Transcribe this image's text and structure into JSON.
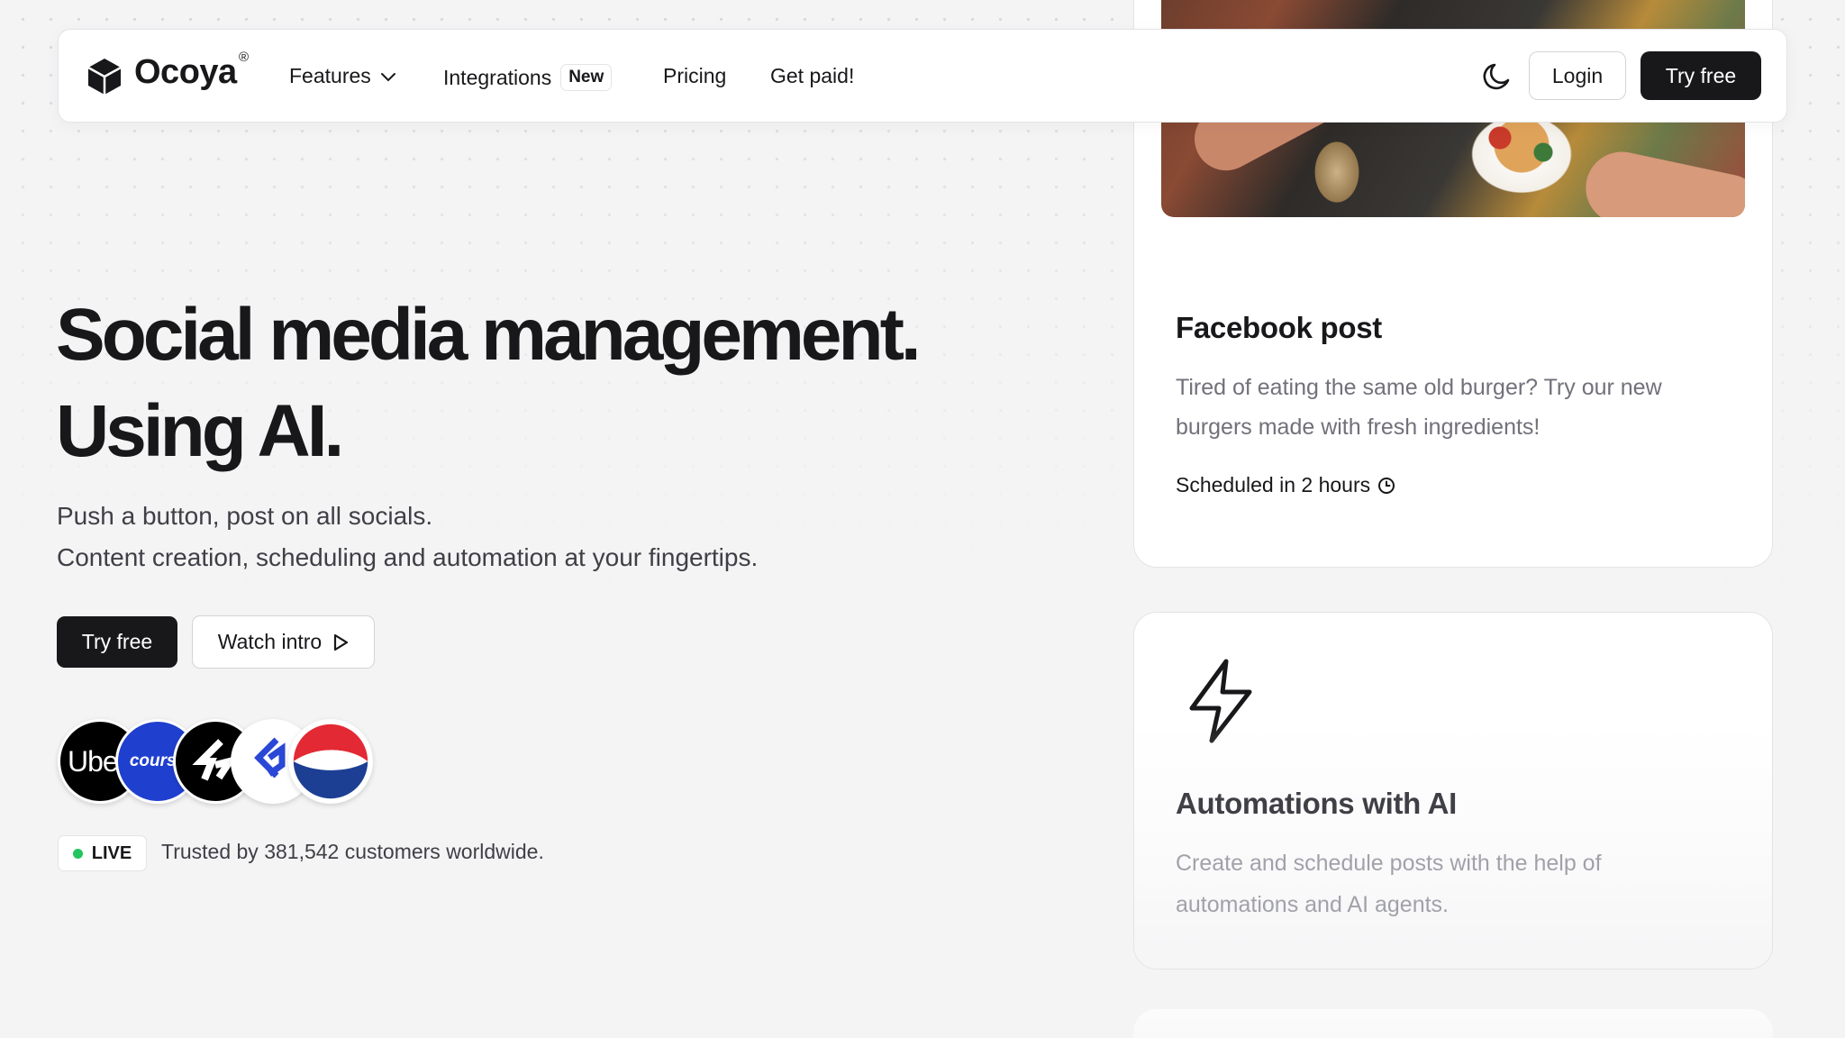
{
  "nav": {
    "logo_text": "Ocoya",
    "logo_reg": "®",
    "features": "Features",
    "integrations": "Integrations",
    "integrations_badge": "New",
    "pricing": "Pricing",
    "get_paid": "Get paid!",
    "login": "Login",
    "try_free": "Try free"
  },
  "hero": {
    "title_line1": "Social media management.",
    "title_line2": "Using AI.",
    "subtitle_line1": "Push a button, post on all socials.",
    "subtitle_line2": "Content creation, scheduling and automation at your fingertips.",
    "try_free": "Try free",
    "watch_intro": "Watch intro",
    "live_label": "LIVE",
    "trusted_text": "Trusted by 381,542 customers worldwide."
  },
  "customer_logos": [
    {
      "name": "uber",
      "text": "Ube"
    },
    {
      "name": "coursera",
      "text": "course"
    },
    {
      "name": "s-brand",
      "text": ""
    },
    {
      "name": "p-brand",
      "text": ""
    },
    {
      "name": "pepsi",
      "text": ""
    }
  ],
  "cards": {
    "facebook": {
      "title": "Facebook post",
      "text": "Tired of eating the same old burger? Try our new burgers made with fresh ingredients!",
      "scheduled": "Scheduled in 2 hours"
    },
    "automations": {
      "title": "Automations with AI",
      "text": "Create and schedule posts with the help of automations and AI agents."
    }
  },
  "colors": {
    "primary": "#18181b",
    "live": "#22c55e",
    "pepsi_red": "#e32934",
    "pepsi_blue": "#1c3f94",
    "coursera_blue": "#1f3fcf"
  },
  "icons": [
    "logo-cube-icon",
    "chevron-down-icon",
    "moon-icon",
    "play-icon",
    "clock-icon",
    "bolt-icon"
  ]
}
